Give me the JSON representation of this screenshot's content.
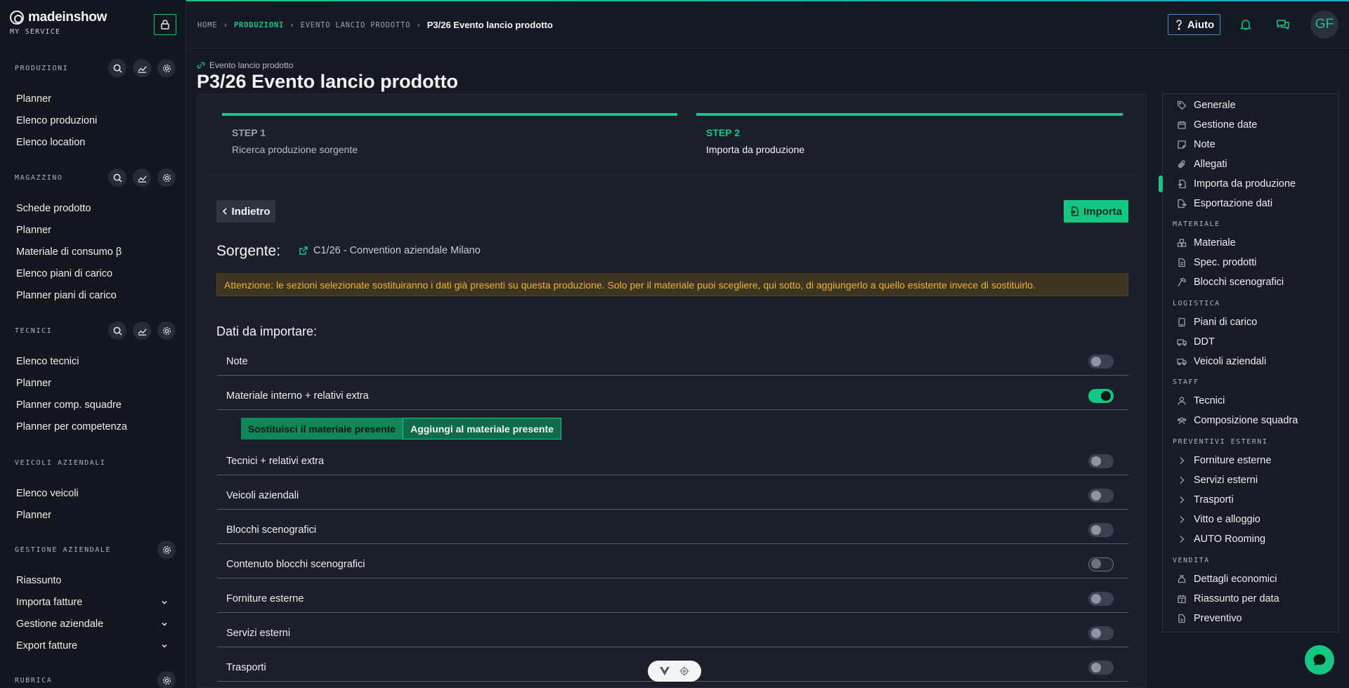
{
  "brand": {
    "name": "madeinshow",
    "subtitle": "MY SERVICE"
  },
  "sidebar": {
    "sections": [
      {
        "title": "PRODUZIONI",
        "items": [
          "Planner",
          "Elenco produzioni",
          "Elenco location"
        ]
      },
      {
        "title": "MAGAZZINO",
        "items": [
          "Schede prodotto",
          "Planner",
          "Materiale di consumo β",
          "Elenco piani di carico",
          "Planner piani di carico"
        ]
      },
      {
        "title": "TECNICI",
        "items": [
          "Elenco tecnici",
          "Planner",
          "Planner comp. squadre",
          "Planner per competenza"
        ]
      },
      {
        "title": "VEICOLI AZIENDALI",
        "items": [
          "Elenco veicoli",
          "Planner"
        ]
      },
      {
        "title": "GESTIONE AZIENDALE",
        "items": [
          "Riassunto",
          "Importa fatture",
          "Gestione aziendale",
          "Export fatture"
        ]
      },
      {
        "title": "RUBRICA",
        "items": []
      }
    ]
  },
  "breadcrumb": {
    "home": "HOME",
    "produzioni": "PRODUZIONI",
    "evento": "EVENTO LANCIO PRODOTTO",
    "current": "P3/26 Evento lancio prodotto"
  },
  "header": {
    "help_label": "Aiuto",
    "avatar_initials": "GF"
  },
  "page": {
    "kicker": "Evento lancio prodotto",
    "title": "P3/26 Evento lancio prodotto"
  },
  "steps": [
    {
      "title": "STEP 1",
      "subtitle": "Ricerca produzione sorgente"
    },
    {
      "title": "STEP 2",
      "subtitle": "Importa da produzione"
    }
  ],
  "actions": {
    "back_label": "Indietro",
    "import_label": "Importa"
  },
  "source": {
    "label": "Sorgente:",
    "value": "C1/26 - Convention aziendale Milano"
  },
  "warning": "Attenzione: le sezioni selezionate sostituiranno i dati già presenti su questa produzione. Solo per il materiale puoi scegliere, qui sotto, di aggiungerlo a quello esistente invece di sostituirlo.",
  "import_section": {
    "heading": "Dati da importare:",
    "options": [
      {
        "label": "Note",
        "state": "off"
      },
      {
        "label": "Materiale interno + relativi extra",
        "state": "on"
      },
      {
        "label": "Tecnici + relativi extra",
        "state": "off"
      },
      {
        "label": "Veicoli aziendali",
        "state": "off"
      },
      {
        "label": "Blocchi scenografici",
        "state": "off"
      },
      {
        "label": "Contenuto blocchi scenografici",
        "state": "outline"
      },
      {
        "label": "Forniture esterne",
        "state": "off"
      },
      {
        "label": "Servizi esterni",
        "state": "off"
      },
      {
        "label": "Trasporti",
        "state": "off"
      }
    ],
    "material_mode": {
      "replace": "Sostituisci il materiale presente",
      "add": "Aggiungi al materiale presente",
      "selected": "add"
    }
  },
  "right_nav": {
    "top": [
      "Generale",
      "Gestione date",
      "Note",
      "Allegati",
      "Importa da produzione",
      "Esportazione dati"
    ],
    "materiale_title": "MATERIALE",
    "materiale": [
      "Materiale",
      "Spec. prodotti",
      "Blocchi scenografici"
    ],
    "logistica_title": "LOGISTICA",
    "logistica": [
      "Piani di carico",
      "DDT",
      "Veicoli aziendali"
    ],
    "staff_title": "STAFF",
    "staff": [
      "Tecnici",
      "Composizione squadra"
    ],
    "preventivi_title": "PREVENTIVI ESTERNI",
    "preventivi": [
      "Forniture esterne",
      "Servizi esterni",
      "Trasporti",
      "Vitto e alloggio",
      "AUTO Rooming"
    ],
    "vendita_title": "VENDITA",
    "vendita": [
      "Dettagli economici",
      "Riassunto per data",
      "Preventivo"
    ],
    "active": "Importa da produzione"
  },
  "colors": {
    "accent": "#16c784",
    "warning": "#f2b12c",
    "help_border": "#4c8ac9"
  }
}
